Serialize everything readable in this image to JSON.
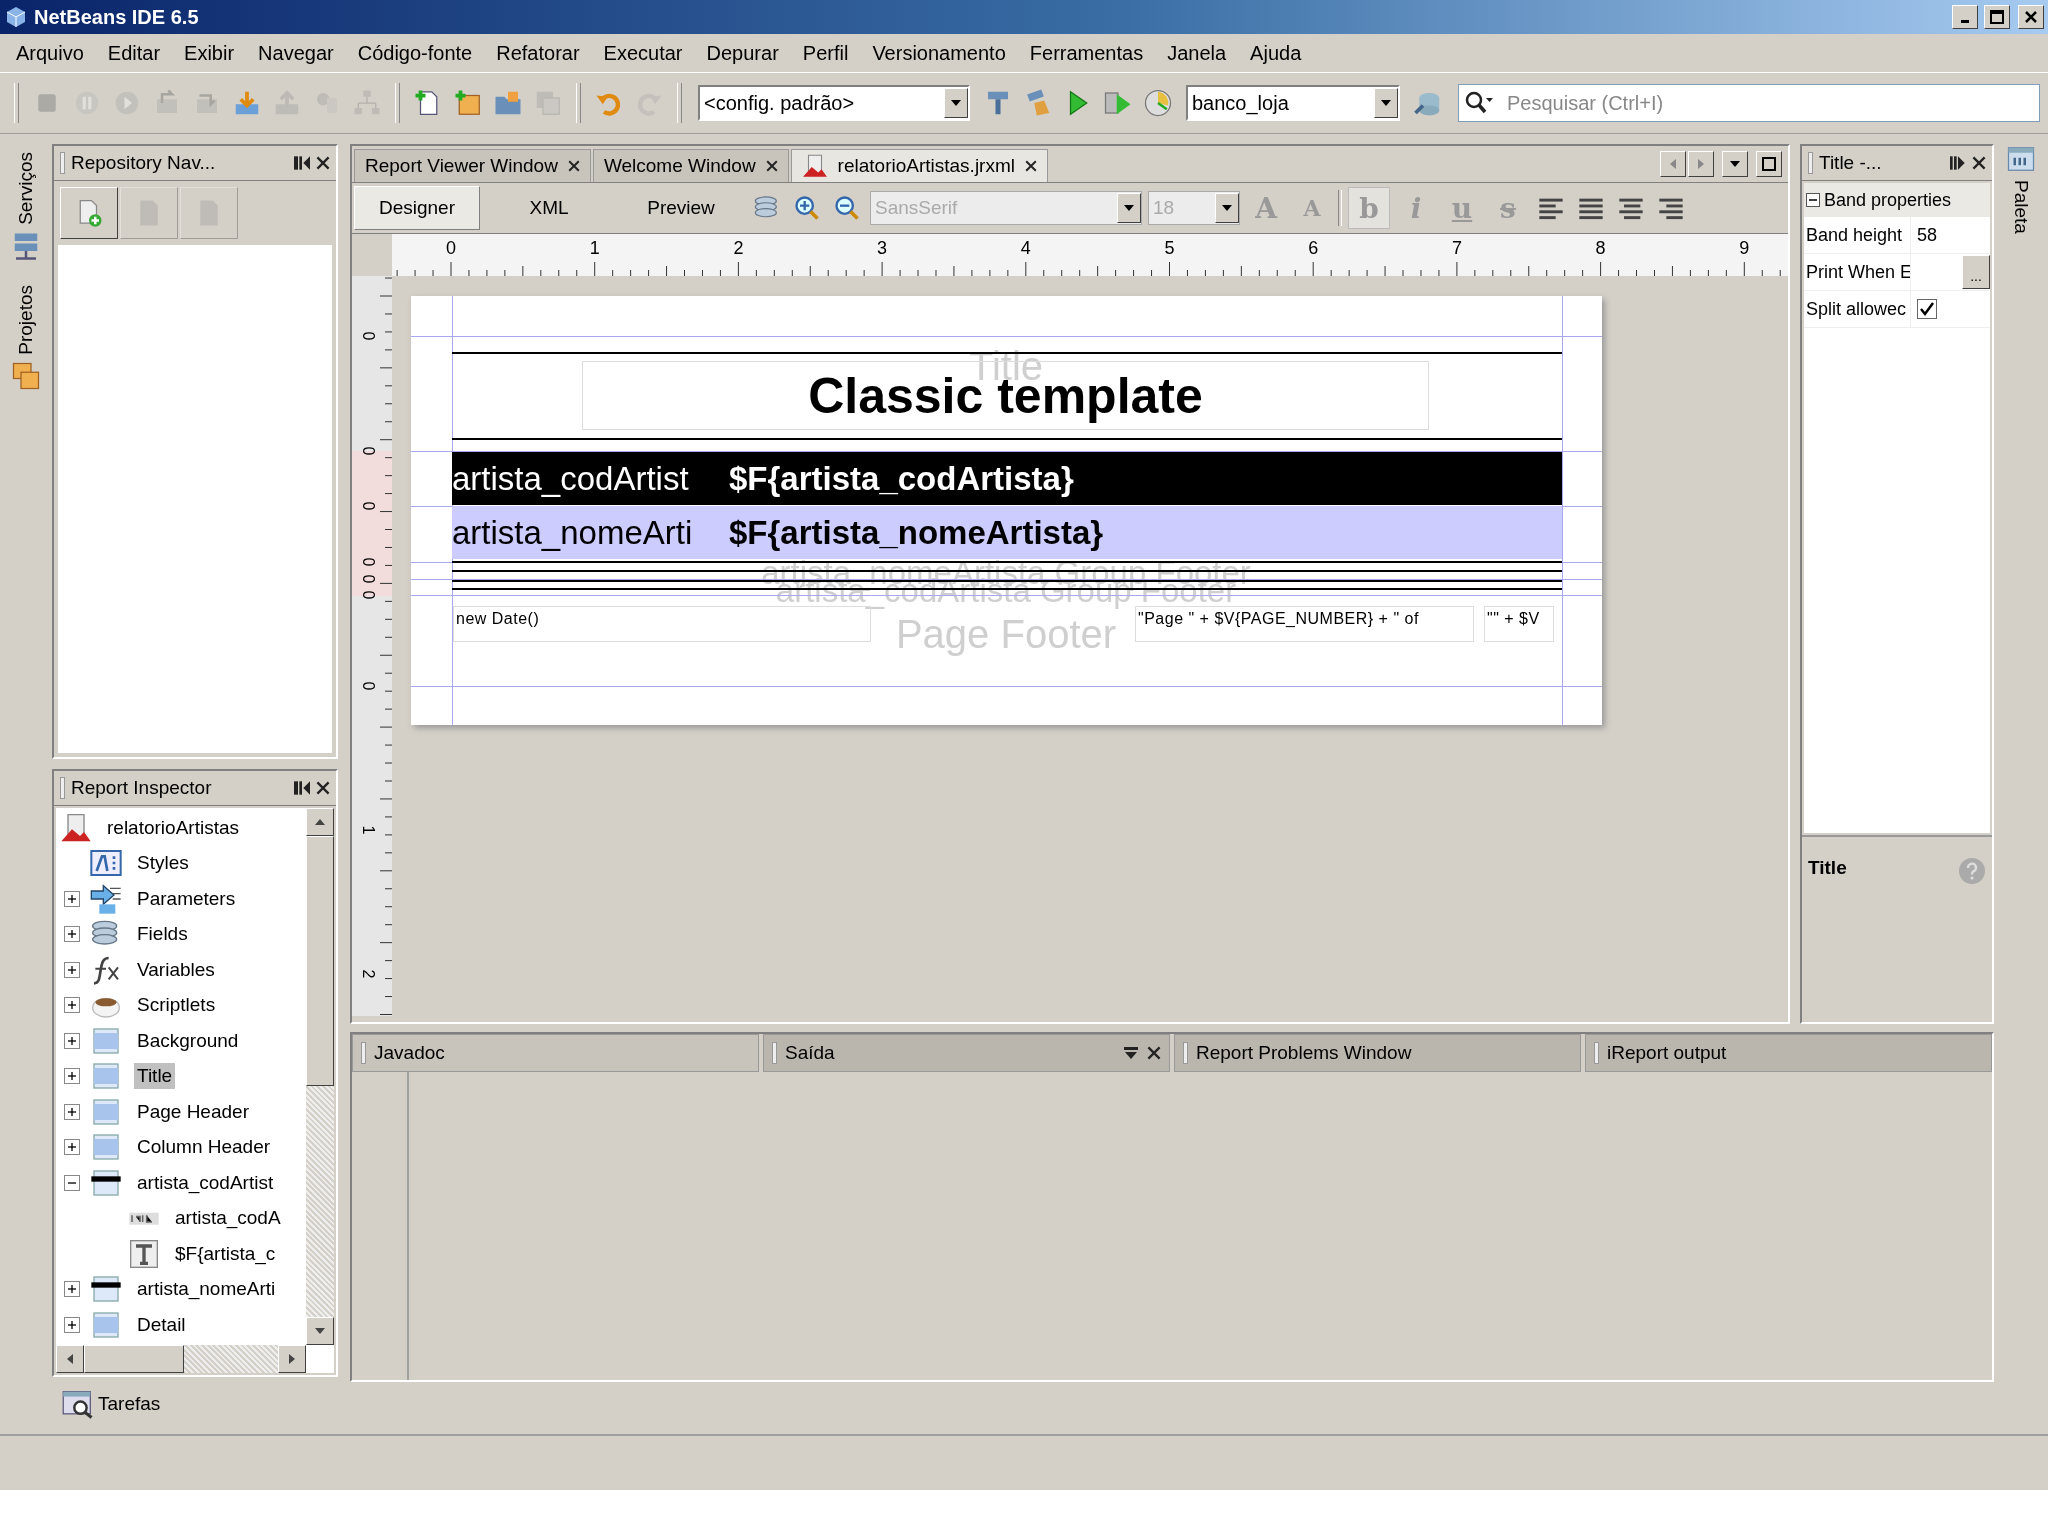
{
  "window": {
    "title": "NetBeans IDE 6.5"
  },
  "menu": [
    "Arquivo",
    "Editar",
    "Exibir",
    "Navegar",
    "Código-fonte",
    "Refatorar",
    "Executar",
    "Depurar",
    "Perfil",
    "Versionamento",
    "Ferramentas",
    "Janela",
    "Ajuda"
  ],
  "toolbar": {
    "groups": [
      [
        {
          "kind": "stop",
          "disabled": true
        },
        {
          "kind": "pause",
          "disabled": true
        },
        {
          "kind": "resume",
          "disabled": true
        },
        {
          "kind": "box-out",
          "disabled": true
        },
        {
          "kind": "box-in",
          "disabled": true
        },
        {
          "kind": "download",
          "disabled": false
        },
        {
          "kind": "upload",
          "disabled": true
        },
        {
          "kind": "step",
          "disabled": true
        },
        {
          "kind": "tree",
          "disabled": true
        }
      ],
      [
        {
          "kind": "new-file",
          "disabled": false
        },
        {
          "kind": "new-project",
          "disabled": false
        },
        {
          "kind": "open",
          "disabled": false
        },
        {
          "kind": "save",
          "disabled": true
        }
      ],
      [
        {
          "kind": "undo",
          "disabled": false
        },
        {
          "kind": "redo",
          "disabled": true
        }
      ]
    ],
    "config": "<config. padrão>",
    "run_group": [
      {
        "kind": "hammer",
        "disabled": false
      },
      {
        "kind": "clean",
        "disabled": false
      },
      {
        "kind": "run",
        "disabled": false
      },
      {
        "kind": "debug",
        "disabled": false
      },
      {
        "kind": "profile",
        "disabled": false
      }
    ],
    "datasource": "banco_loja",
    "search": {
      "placeholder": "Pesquisar (Ctrl+I)"
    }
  },
  "left_strip": [
    {
      "label": "Serviços",
      "kind": "services"
    },
    {
      "label": "Projetos",
      "kind": "projects"
    }
  ],
  "right_strip": [
    {
      "label": "Paleta",
      "kind": "palette"
    }
  ],
  "repository": {
    "title": "Repository Nav...",
    "buttons": [
      {
        "kind": "add",
        "disabled": false
      },
      {
        "kind": "doc",
        "disabled": true
      },
      {
        "kind": "doc",
        "disabled": true
      }
    ]
  },
  "inspector": {
    "title": "Report Inspector",
    "tree": [
      {
        "label": "relatorioArtistas",
        "kind": "report",
        "selected": false,
        "children": [
          {
            "label": "Styles",
            "kind": "styles",
            "selected": false
          },
          {
            "label": "Parameters",
            "kind": "parameters",
            "expanded": false,
            "selected": false
          },
          {
            "label": "Fields",
            "kind": "fields",
            "expanded": false,
            "selected": false
          },
          {
            "label": "Variables",
            "kind": "variables",
            "expanded": false,
            "selected": false
          },
          {
            "label": "Scriptlets",
            "kind": "scriptlets",
            "expanded": false,
            "selected": false
          },
          {
            "label": "Background",
            "kind": "band",
            "expanded": false,
            "selected": false
          },
          {
            "label": "Title",
            "kind": "band",
            "expanded": false,
            "selected": true
          },
          {
            "label": "Page Header",
            "kind": "band",
            "expanded": false,
            "selected": false
          },
          {
            "label": "Column Header",
            "kind": "band",
            "expanded": false,
            "selected": false
          },
          {
            "label": "artista_codArtist",
            "kind": "group",
            "expanded": true,
            "selected": false,
            "children": [
              {
                "label": "artista_codA",
                "kind": "label",
                "selected": false
              },
              {
                "label": "$F{artista_c",
                "kind": "textfield",
                "selected": false
              }
            ]
          },
          {
            "label": "artista_nomeArti",
            "kind": "group",
            "expanded": false,
            "selected": false
          },
          {
            "label": "Detail",
            "kind": "band",
            "expanded": false,
            "selected": false
          }
        ]
      }
    ]
  },
  "editor": {
    "tabs": [
      {
        "label": "Report Viewer Window",
        "kind": "plain",
        "selected": false
      },
      {
        "label": "Welcome Window",
        "kind": "plain",
        "selected": false
      },
      {
        "label": "relatorioArtistas.jrxml",
        "kind": "report",
        "selected": true
      }
    ],
    "views": [
      {
        "label": "Designer",
        "selected": true
      },
      {
        "label": "XML",
        "selected": false
      },
      {
        "label": "Preview",
        "selected": false
      }
    ],
    "format": {
      "font": "SansSerif",
      "size": "18",
      "grow": "A",
      "shrink": "A",
      "bold": "b",
      "italic": "i",
      "underline": "u",
      "strike": "s"
    },
    "ruler": {
      "h": [
        "0",
        "1",
        "2",
        "3",
        "4",
        "5",
        "6",
        "7",
        "8",
        "9"
      ],
      "v": [
        "0",
        "0",
        "0",
        "0",
        "0",
        "0",
        "0",
        "1",
        "2"
      ]
    },
    "report": {
      "title_label": "Title",
      "title_text": "Classic template",
      "group_headers": [
        {
          "label": "artista_codArtist",
          "field": "$F{artista_codArtista}",
          "kind": "dark"
        },
        {
          "label": "artista_nomeArti",
          "field": "$F{artista_nomeArtista}",
          "kind": "light"
        }
      ],
      "group_footer_labels": [
        "artista_nomeArtista Group Footer",
        "artista_codArtista Group Footer"
      ],
      "page_footer_label": "Page Footer",
      "footer_fields": [
        "new Date()",
        "\"Page \" + $V{PAGE_NUMBER} + \" of",
        "\"\" + $V"
      ]
    }
  },
  "properties": {
    "title": "Title -...",
    "section": "Band properties",
    "expanded": true,
    "rows": [
      {
        "name": "Band height",
        "kind": "text",
        "value": "58"
      },
      {
        "name": "Print When E",
        "kind": "button",
        "button": "..."
      },
      {
        "name": "Split allowec",
        "kind": "checkbox",
        "checked": true
      }
    ],
    "description": "Title"
  },
  "output": {
    "tabs": [
      {
        "label": "Javadoc",
        "selected": true
      },
      {
        "label": "Saída",
        "selected": false
      },
      {
        "label": "Report Problems Window",
        "selected": false
      },
      {
        "label": "iReport output",
        "selected": false
      }
    ]
  },
  "tasks": {
    "label": "Tarefas"
  }
}
